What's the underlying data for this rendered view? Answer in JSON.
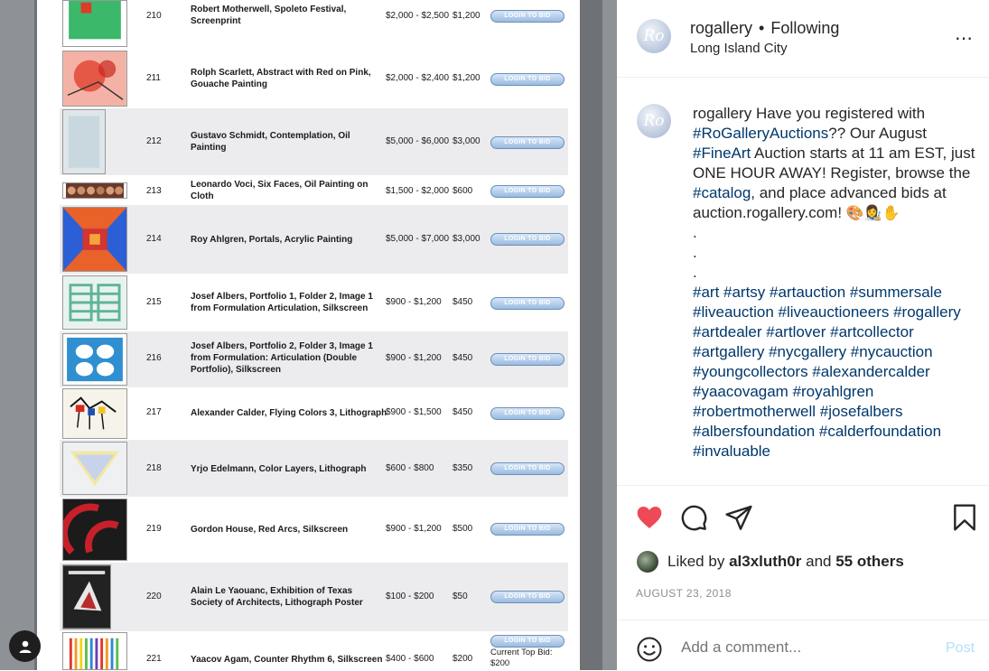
{
  "lots": [
    {
      "no": "210",
      "title": "Robert Motherwell, Spoleto Festival, Screenprint",
      "estimate": "$2,000 - $2,500",
      "opening": "$1,200",
      "bid_label": "LOGIN TO BID"
    },
    {
      "no": "211",
      "title": "Rolph Scarlett, Abstract with Red on Pink, Gouache Painting",
      "estimate": "$2,000 - $2,400",
      "opening": "$1,200",
      "bid_label": "LOGIN TO BID"
    },
    {
      "no": "212",
      "title": "Gustavo Schmidt, Contemplation, Oil Painting",
      "estimate": "$5,000 - $6,000",
      "opening": "$3,000",
      "bid_label": "LOGIN TO BID"
    },
    {
      "no": "213",
      "title": "Leonardo Voci, Six Faces, Oil Painting on Cloth",
      "estimate": "$1,500 - $2,000",
      "opening": "$600",
      "bid_label": "LOGIN TO BID"
    },
    {
      "no": "214",
      "title": "Roy Ahlgren, Portals, Acrylic Painting",
      "estimate": "$5,000 - $7,000",
      "opening": "$3,000",
      "bid_label": "LOGIN TO BID"
    },
    {
      "no": "215",
      "title": "Josef Albers, Portfolio 1, Folder 2, Image 1 from Formulation Articulation, Silkscreen",
      "estimate": "$900 - $1,200",
      "opening": "$450",
      "bid_label": "LOGIN TO BID"
    },
    {
      "no": "216",
      "title": "Josef Albers, Portfolio 2, Folder 3, Image 1 from Formulation: Articulation (Double Portfolio), Silkscreen",
      "estimate": "$900 - $1,200",
      "opening": "$450",
      "bid_label": "LOGIN TO BID"
    },
    {
      "no": "217",
      "title": "Alexander Calder, Flying Colors 3, Lithograph",
      "estimate": "$900 - $1,500",
      "opening": "$450",
      "bid_label": "LOGIN TO BID"
    },
    {
      "no": "218",
      "title": "Yrjo Edelmann, Color Layers, Lithograph",
      "estimate": "$600 - $800",
      "opening": "$350",
      "bid_label": "LOGIN TO BID"
    },
    {
      "no": "219",
      "title": "Gordon House, Red Arcs, Silkscreen",
      "estimate": "$900 - $1,200",
      "opening": "$500",
      "bid_label": "LOGIN TO BID"
    },
    {
      "no": "220",
      "title": "Alain Le Yaouanc, Exhibition of Texas Society of Architects, Lithograph Poster",
      "estimate": "$100 - $200",
      "opening": "$50",
      "bid_label": "LOGIN TO BID"
    },
    {
      "no": "221",
      "title": "Yaacov Agam, Counter Rhythm 6, Silkscreen",
      "estimate": "$400 - $600",
      "opening": "$200",
      "bid_label": "LOGIN TO BID",
      "top_bid": "Current Top Bid: $200"
    }
  ],
  "header": {
    "username": "rogallery",
    "separator": "•",
    "follow_status": "Following",
    "location": "Long Island City",
    "avatar_text": "Ro",
    "more_icon": "⋯"
  },
  "caption": {
    "username": "rogallery",
    "part1": "Have you registered with",
    "tag1": "#RoGalleryAuctions",
    "part2": "?? Our August",
    "tag2": "#FineArt",
    "part3": "Auction starts at 11 am EST, just ONE HOUR AWAY! Register, browse the",
    "tag3": "#catalog",
    "part4": ", and place advanced bids at auction.rogallery.com!",
    "emojis": "🎨👩‍🎨✋",
    "dots": [
      ".",
      ".",
      "."
    ],
    "hashtags": "#art #artsy #artauction #summersale #liveauction #liveauctioneers #rogallery #artdealer #artlover #artcollector #artgallery #nycgallery #nycauction #youngcollectors #alexandercalder #yaacovagam #royahlgren #robertmotherwell #josefalbers #albersfoundation #calderfoundation #invaluable"
  },
  "likes": {
    "prefix": "Liked by",
    "user": "al3xluth0r",
    "and": "and",
    "others": "55 others"
  },
  "date": "AUGUST 23, 2018",
  "comment": {
    "placeholder": "Add a comment...",
    "post_label": "Post"
  },
  "colors": {
    "heart": "#ed4956",
    "hashtag": "#00376b",
    "post_button": "#b2dffc"
  }
}
